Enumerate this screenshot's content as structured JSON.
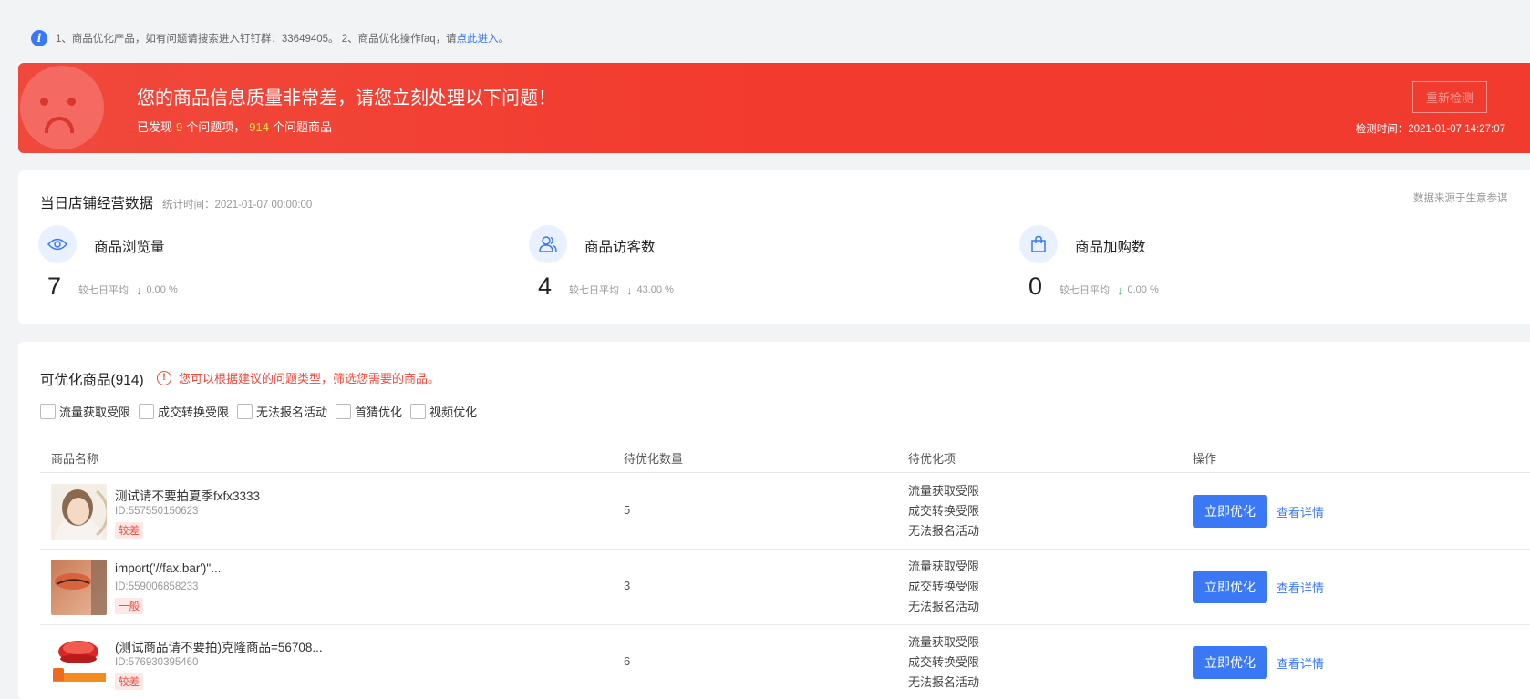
{
  "notice": {
    "text": "1、商品优化产品，如有问题请搜索进入钉钉群：33649405。 2、商品优化操作faq，请",
    "link": "点此进入",
    "suffix": "。"
  },
  "alert": {
    "title": "您的商品信息质量非常差，请您立刻处理以下问题！",
    "found_prefix": "已发现",
    "issue_count": "9",
    "issue_suffix": "个问题项，",
    "product_count": "914",
    "product_suffix": "个问题商品",
    "recheck_label": "重新检测",
    "check_time": "检测时间：2021-01-07 14:27:07",
    "colors": {
      "background": "#f23b2f",
      "highlight": "#ffe14d"
    }
  },
  "stats": {
    "title": "当日店铺经营数据",
    "stat_time": "统计时间：2021-01-07 00:00:00",
    "source": "数据来源于生意参谋",
    "metrics": [
      {
        "icon": "eye-icon",
        "label": "商品浏览量",
        "value": "7",
        "compare_label": "较七日平均",
        "trend": "down",
        "percent": "0.00 %"
      },
      {
        "icon": "users-icon",
        "label": "商品访客数",
        "value": "4",
        "compare_label": "较七日平均",
        "trend": "down",
        "percent": "43.00 %"
      },
      {
        "icon": "shopping-bag-icon",
        "label": "商品加购数",
        "value": "0",
        "compare_label": "较七日平均",
        "trend": "down",
        "percent": "0.00 %"
      }
    ]
  },
  "products": {
    "title": "可优化商品(914)",
    "tip": "您可以根据建议的问题类型，筛选您需要的商品。",
    "filters": [
      "流量获取受限",
      "成交转换受限",
      "无法报名活动",
      "首猜优化",
      "视频优化"
    ],
    "columns": [
      "商品名称",
      "待优化数量",
      "待优化项",
      "操作"
    ],
    "rows": [
      {
        "name": "测试请不要拍夏季fxfx3333",
        "id": "ID:557550150623",
        "grade": "较差",
        "count": "5",
        "issues": [
          "流量获取受限",
          "成交转换受限",
          "无法报名活动"
        ],
        "optimize_label": "立即优化",
        "detail_label": "查看详情"
      },
      {
        "name": "import('//fax.bar')\"...",
        "id": "ID:559006858233",
        "grade": "一般",
        "count": "3",
        "issues": [
          "流量获取受限",
          "成交转换受限",
          "无法报名活动"
        ],
        "optimize_label": "立即优化",
        "detail_label": "查看详情"
      },
      {
        "name": "(测试商品请不要拍)克隆商品=56708...",
        "id": "ID:576930395460",
        "grade": "较差",
        "count": "6",
        "issues": [
          "流量获取受限",
          "成交转换受限",
          "无法报名活动"
        ],
        "optimize_label": "立即优化",
        "detail_label": "查看详情"
      }
    ]
  },
  "theme": {
    "primary": "#3b78f6",
    "danger": "#f0493c",
    "success": "#2bbb5c"
  }
}
